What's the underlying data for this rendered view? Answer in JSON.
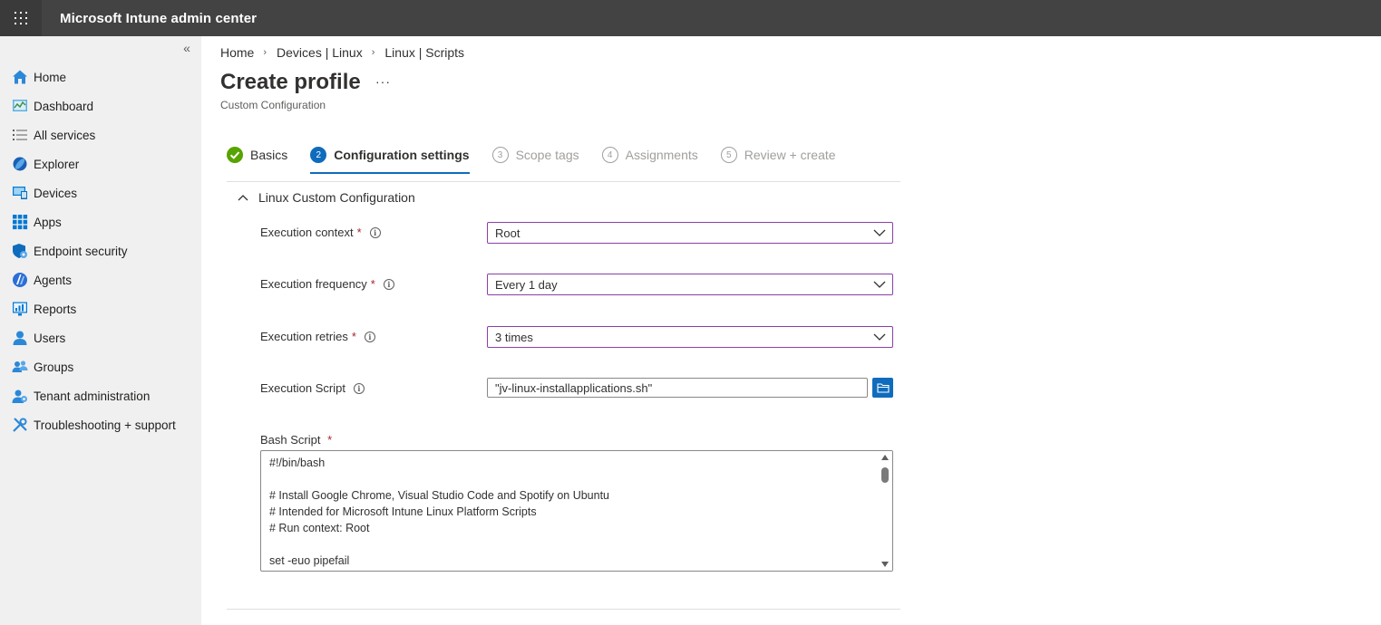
{
  "app": {
    "title": "Microsoft Intune admin center"
  },
  "sidebar": {
    "collapse_glyph": "«",
    "items": [
      {
        "label": "Home",
        "icon": "home-icon"
      },
      {
        "label": "Dashboard",
        "icon": "dashboard-icon"
      },
      {
        "label": "All services",
        "icon": "list-icon"
      },
      {
        "label": "Explorer",
        "icon": "explorer-icon"
      },
      {
        "label": "Devices",
        "icon": "devices-icon"
      },
      {
        "label": "Apps",
        "icon": "apps-icon"
      },
      {
        "label": "Endpoint security",
        "icon": "shield-icon"
      },
      {
        "label": "Agents",
        "icon": "agents-icon"
      },
      {
        "label": "Reports",
        "icon": "reports-icon"
      },
      {
        "label": "Users",
        "icon": "user-icon"
      },
      {
        "label": "Groups",
        "icon": "groups-icon"
      },
      {
        "label": "Tenant administration",
        "icon": "tenant-admin-icon"
      },
      {
        "label": "Troubleshooting + support",
        "icon": "wrench-icon"
      }
    ]
  },
  "breadcrumb": [
    "Home",
    "Devices | Linux",
    "Linux | Scripts"
  ],
  "page": {
    "title": "Create profile",
    "more": "···",
    "subtitle": "Custom Configuration"
  },
  "steps": [
    {
      "num": "1",
      "label": "Basics",
      "state": "done"
    },
    {
      "num": "2",
      "label": "Configuration settings",
      "state": "active"
    },
    {
      "num": "3",
      "label": "Scope tags",
      "state": "inactive"
    },
    {
      "num": "4",
      "label": "Assignments",
      "state": "inactive"
    },
    {
      "num": "5",
      "label": "Review + create",
      "state": "inactive"
    }
  ],
  "section": {
    "title": "Linux Custom Configuration"
  },
  "fields": {
    "execution_context": {
      "label": "Execution context",
      "required": "*",
      "value": "Root"
    },
    "execution_frequency": {
      "label": "Execution frequency",
      "required": "*",
      "value": "Every 1 day"
    },
    "execution_retries": {
      "label": "Execution retries",
      "required": "*",
      "value": "3 times"
    },
    "execution_script": {
      "label": "Execution Script",
      "value": "\"jv-linux-installapplications.sh\""
    },
    "bash_script": {
      "label": "Bash Script",
      "required": "*",
      "content": "#!/bin/bash\n\n# Install Google Chrome, Visual Studio Code and Spotify on Ubuntu\n# Intended for Microsoft Intune Linux Platform Scripts\n# Run context: Root\n\nset -euo pipefail"
    }
  },
  "colors": {
    "topbar": "#434343",
    "sidebar": "#f0f0f0",
    "accent": "#0f6cbd",
    "success": "#57a300",
    "focus_border": "#8a3fa7",
    "required": "#a4262c"
  }
}
